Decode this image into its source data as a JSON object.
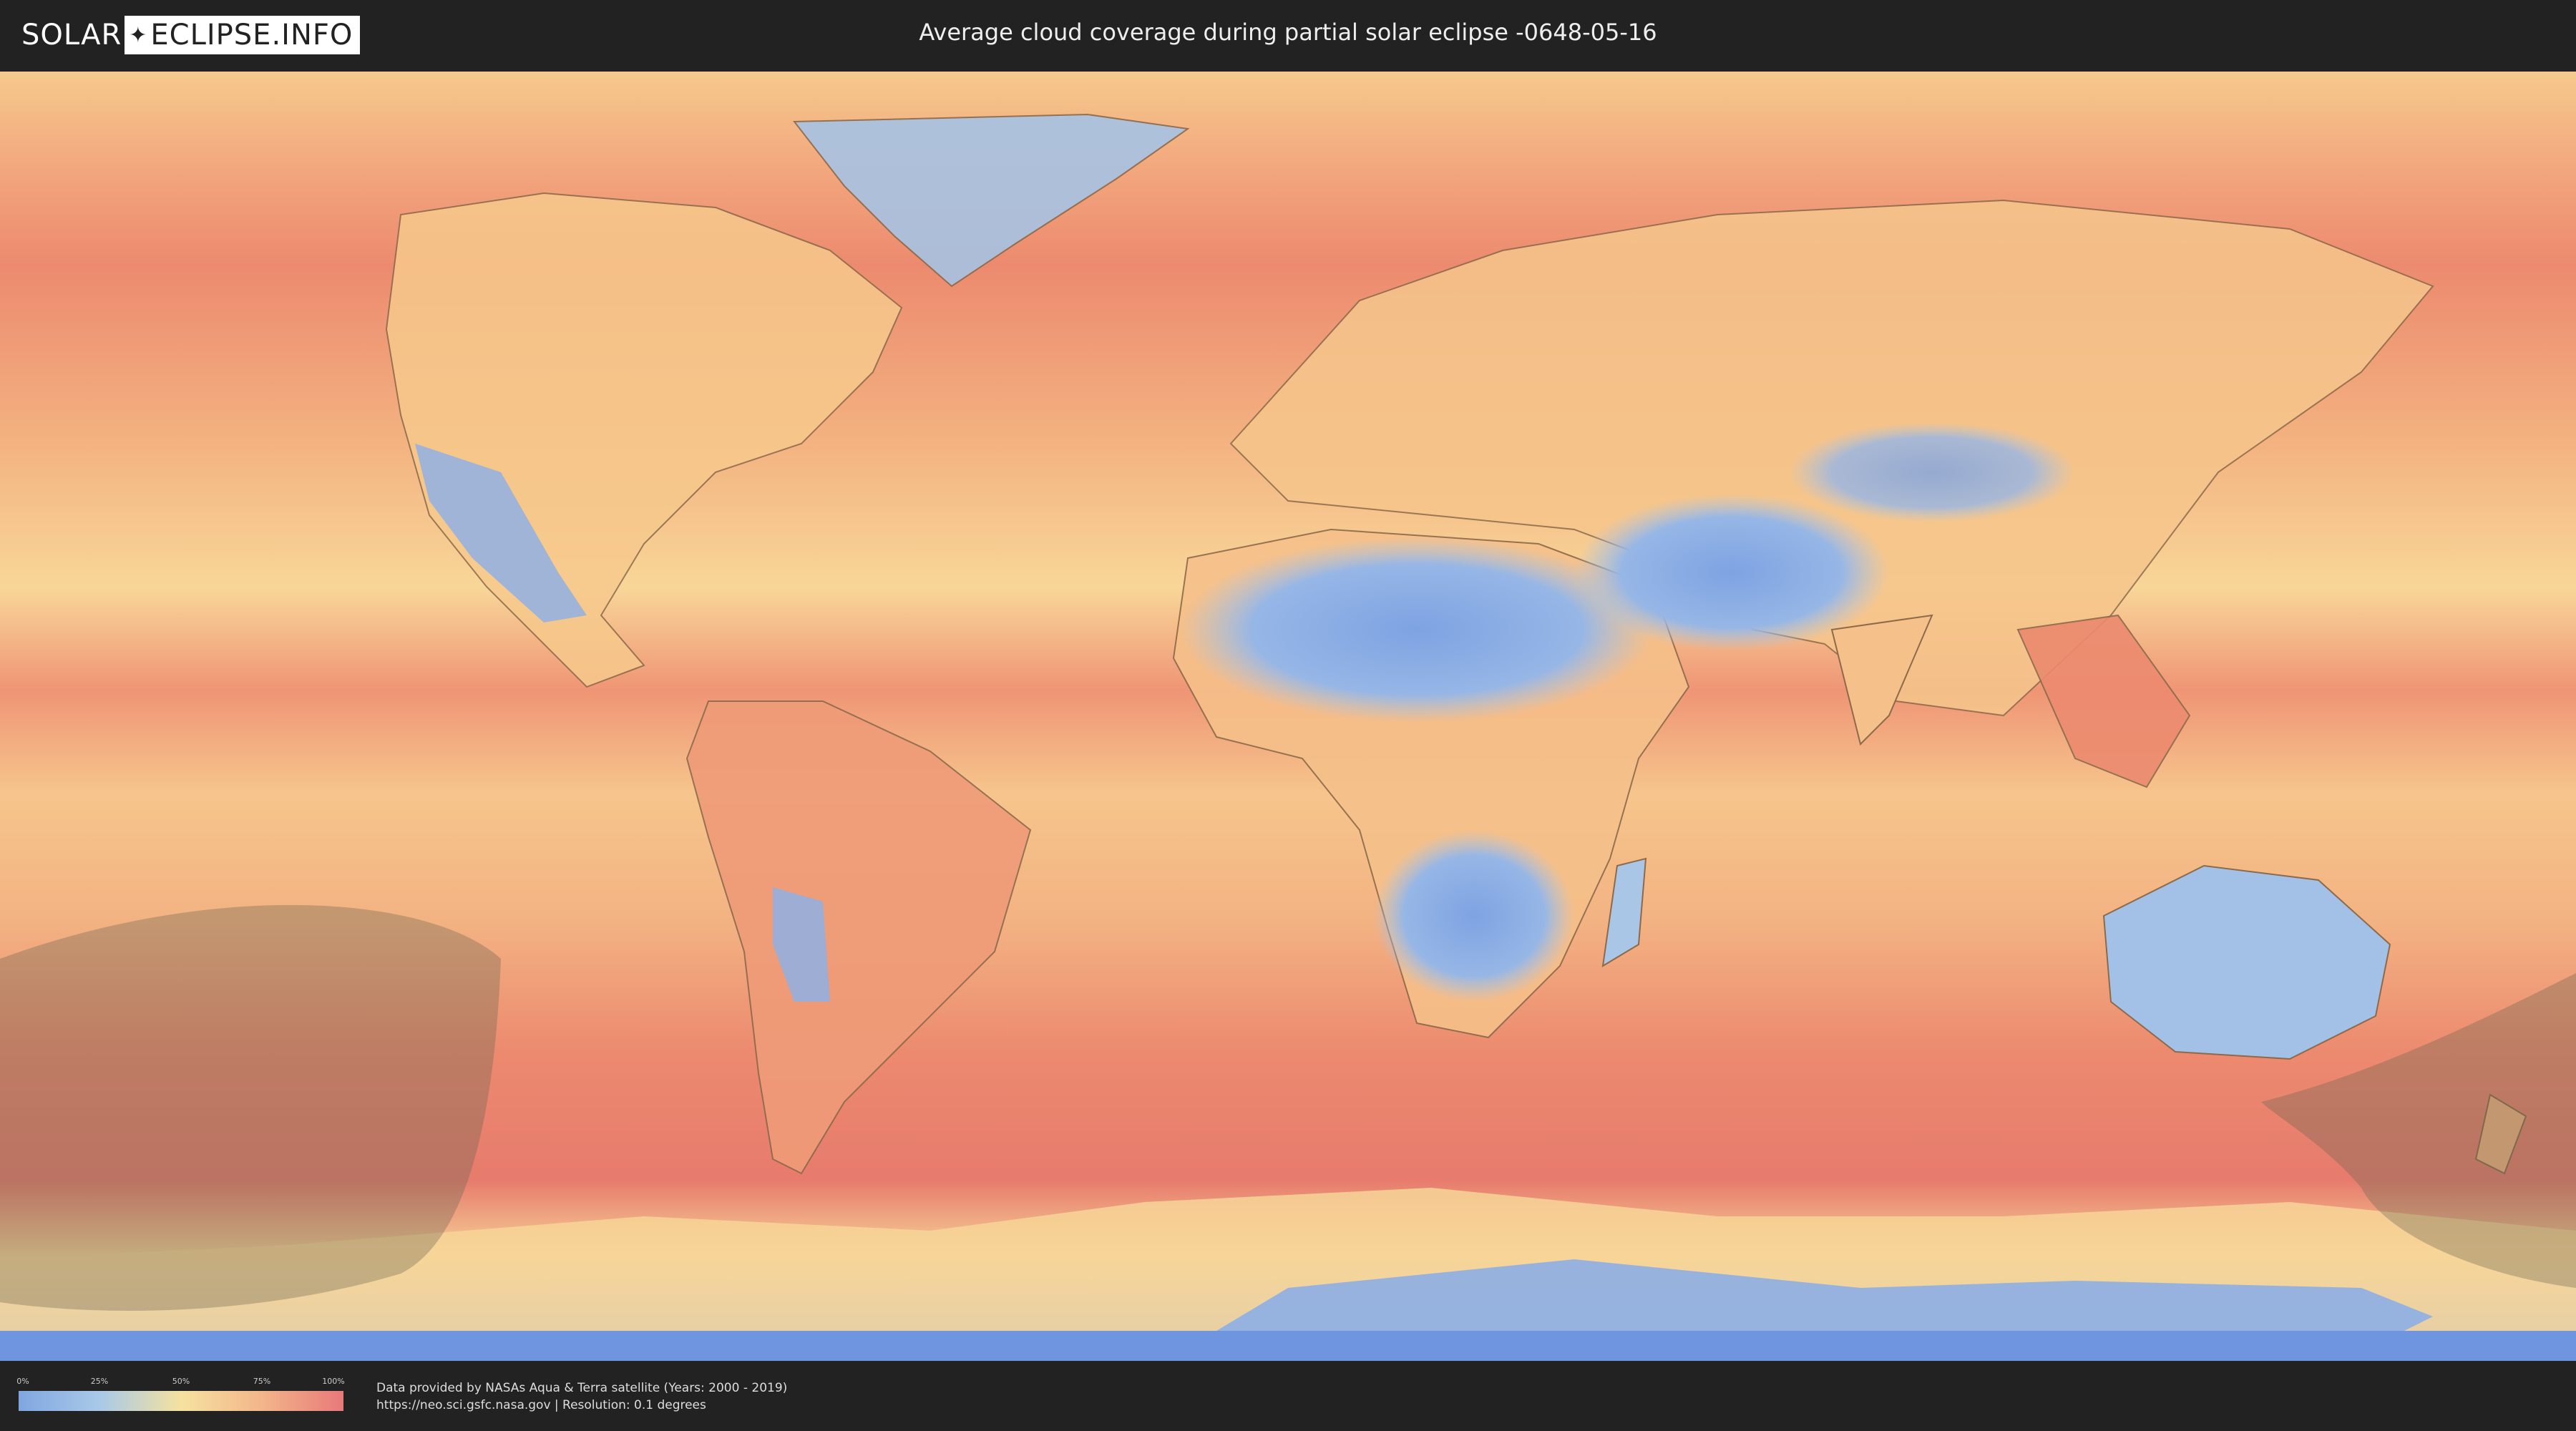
{
  "header": {
    "logo_solar": "SOLAR",
    "logo_eclipse": "ECLIPSE.INFO",
    "title": "Average cloud coverage during partial solar eclipse -0648-05-16"
  },
  "legend": {
    "ticks": [
      "0%",
      "25%",
      "50%",
      "75%",
      "100%"
    ],
    "gradient_colors": [
      "#7fa6e0",
      "#a9c9e8",
      "#f5e2a0",
      "#f3b58a",
      "#e8797a"
    ]
  },
  "footer": {
    "credit_line_1": "Data provided by NASAs Aqua & Terra satellite (Years: 2000 - 2019)",
    "credit_line_2": "https://neo.sci.gsfc.nasa.gov | Resolution: 0.1 degrees"
  },
  "map": {
    "colors": {
      "ocean_cloudy": "#ec8a6f",
      "mid_cloud": "#f7c98c",
      "low_cloud": "#a3c1e6",
      "clear": "#7ea3e2",
      "eclipse_shadow": "#6b6350",
      "coastline": "#8c6a4a"
    },
    "icons": [
      "world-map",
      "eclipse-penumbra-shadow"
    ]
  }
}
